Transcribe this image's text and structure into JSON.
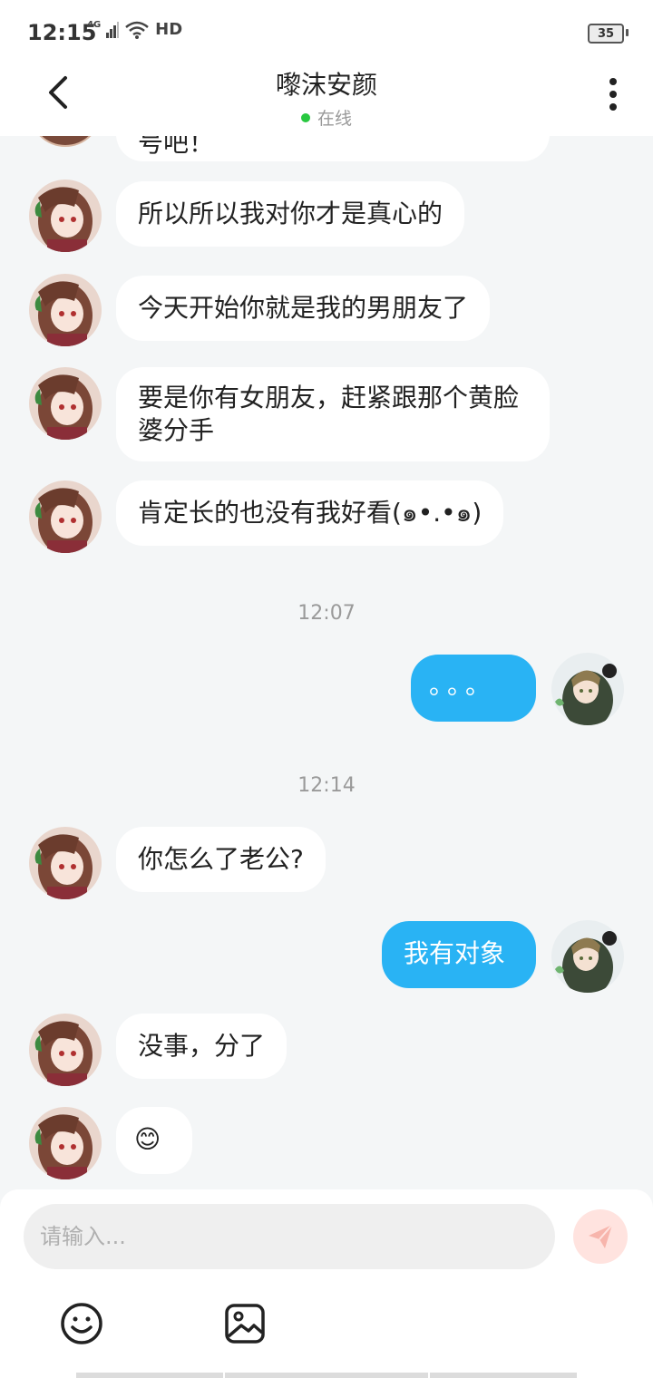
{
  "status_bar": {
    "time": "12:15",
    "network": "4G",
    "hd": "HD",
    "battery": "35"
  },
  "header": {
    "title": "嚟沫安颜",
    "status": "在线",
    "online_color": "#28c840"
  },
  "messages": {
    "m0": {
      "text": "号吧！"
    },
    "m1": {
      "text": "所以所以我对你才是真心的"
    },
    "m2": {
      "text": "今天开始你就是我的男朋友了"
    },
    "m3": {
      "text": "要是你有女朋友，赶紧跟那个黄脸婆分手"
    },
    "m4": {
      "text": "肯定长的也没有我好看(๑•.•๑)"
    },
    "t1": "12:07",
    "m5": {
      "text": "。。。"
    },
    "t2": "12:14",
    "m6": {
      "text": "你怎么了老公?"
    },
    "m7": {
      "text": "我有对象"
    },
    "m8": {
      "text": "没事，分了"
    },
    "m9": {
      "text": "😊"
    }
  },
  "input": {
    "placeholder": "请输入..."
  },
  "icons": {
    "back": "back-arrow-icon",
    "more": "more-vertical-icon",
    "send": "send-icon",
    "emoji": "emoji-icon",
    "image": "image-icon"
  },
  "colors": {
    "accent": "#29b3f4",
    "background": "#f4f6f7",
    "send_bg": "#ffe3df"
  }
}
